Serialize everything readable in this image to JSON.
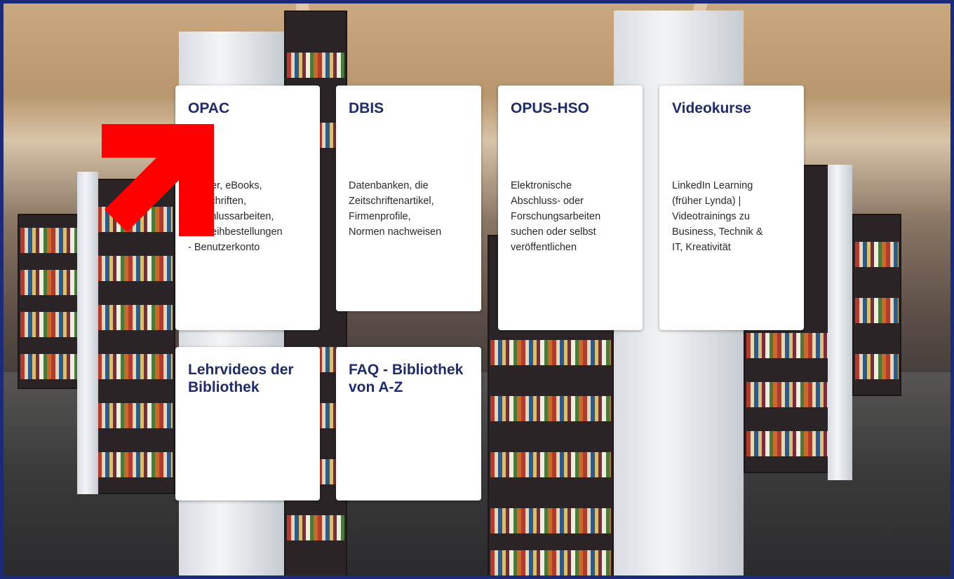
{
  "cards": [
    {
      "title": "OPAC",
      "description": "Bücher, eBooks,\nZeitschriften,\nAbschlussarbeiten,\nFernleihbestellungen\n- Benutzerkonto"
    },
    {
      "title": "DBIS",
      "description": "Datenbanken, die\nZeitschriftenartikel,\nFirmenprofile,\nNormen nachweisen"
    },
    {
      "title": "OPUS-HSO",
      "description": "Elektronische\nAbschluss- oder\nForschungsarbeiten\nsuchen oder selbst\nveröffentlichen"
    },
    {
      "title": "Videokurse",
      "description": "LinkedIn Learning\n(früher Lynda) |\nVideotrainings zu\nBusiness, Technik &\nIT, Kreativität"
    },
    {
      "title": "Lehrvideos der Bibliothek",
      "description": ""
    },
    {
      "title": "FAQ - Bibliothek von A-Z",
      "description": ""
    }
  ],
  "colors": {
    "frame_border": "#1c2a7a",
    "card_title": "#1f2b6e",
    "annotation_arrow": "#ff0000"
  },
  "annotation": {
    "icon": "arrow-up-right-icon"
  }
}
